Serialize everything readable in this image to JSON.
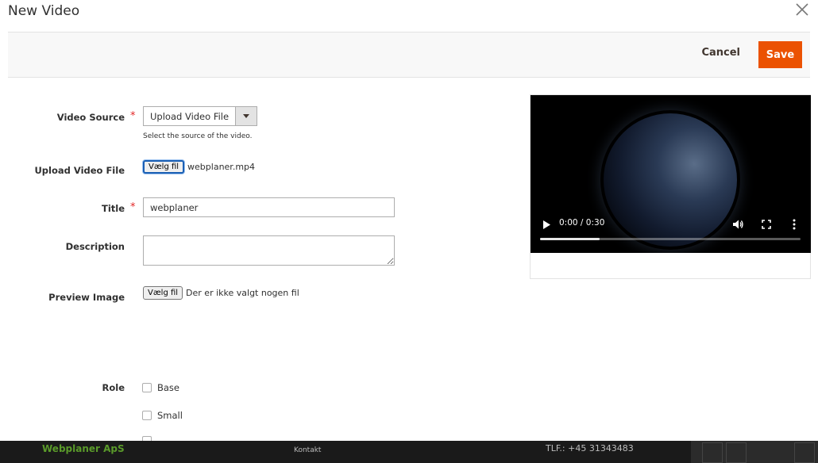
{
  "modal": {
    "title": "New Video",
    "cancel_label": "Cancel",
    "save_label": "Save"
  },
  "form": {
    "video_source": {
      "label": "Video Source",
      "required_mark": "*",
      "selected": "Upload Video File",
      "note": "Select the source of the video."
    },
    "upload_video_file": {
      "label": "Upload Video File",
      "button_label": "Vælg fil",
      "file_name": "webplaner.mp4"
    },
    "title": {
      "label": "Title",
      "required_mark": "*",
      "value": "webplaner"
    },
    "description": {
      "label": "Description",
      "value": ""
    },
    "preview_image": {
      "label": "Preview Image",
      "button_label": "Vælg fil",
      "file_name": "Der er ikke valgt nogen fil"
    },
    "role": {
      "label": "Role",
      "options": [
        {
          "label": "Base",
          "checked": false
        },
        {
          "label": "Small",
          "checked": false
        }
      ]
    }
  },
  "video_player": {
    "time": "0:00 / 0:30",
    "progress": 0.23
  },
  "footer": {
    "brand": "Webplaner ApS",
    "link": "Kontakt",
    "phone": "TLF.: +45 31343483"
  },
  "colors": {
    "accent": "#eb5202",
    "required": "#e22626",
    "footer_brand": "#5a9a2a"
  }
}
